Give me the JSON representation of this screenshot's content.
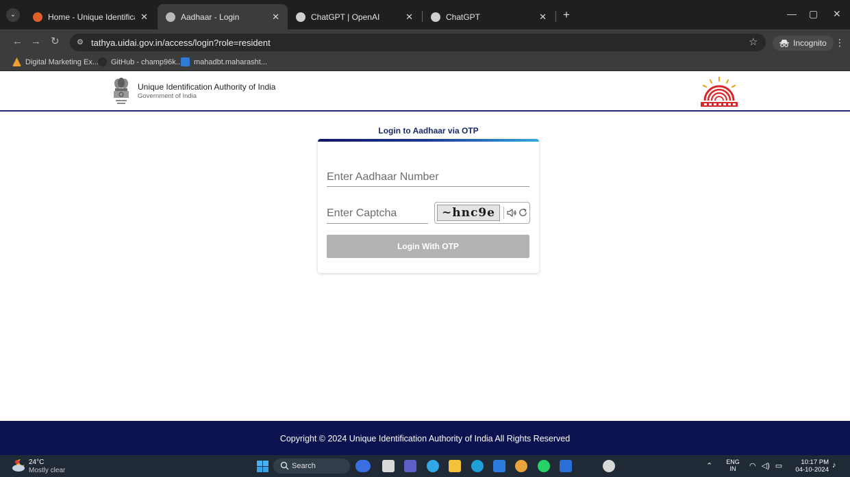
{
  "browser": {
    "tabs": [
      {
        "title": "Home - Unique Identification A",
        "close": "✕",
        "active": false,
        "favicon_color": "#e0602a"
      },
      {
        "title": "Aadhaar - Login",
        "close": "✕",
        "active": true,
        "favicon_color": "#b8b8b8"
      },
      {
        "title": "ChatGPT | OpenAI",
        "close": "✕",
        "active": false,
        "favicon_color": "#cfcfcf"
      },
      {
        "title": "ChatGPT",
        "close": "✕",
        "active": false,
        "favicon_color": "#cfcfcf"
      }
    ],
    "new_tab": "+",
    "url": "tathya.uidai.gov.in/access/login?role=resident",
    "incognito_label": "Incognito",
    "bookmarks": [
      {
        "label": "Digital Marketing Ex...",
        "icon_color": "#f0a030"
      },
      {
        "label": "GitHub - champ96k...",
        "icon_color": "#2a2a2a"
      },
      {
        "label": "mahadbt.maharasht...",
        "icon_color": "#2f7bd8"
      }
    ]
  },
  "site": {
    "org_name": "Unique Identification Authority of India",
    "org_sub": "Government of India"
  },
  "login": {
    "heading": "Login to Aadhaar via OTP",
    "aadhaar_placeholder": "Enter Aadhaar Number",
    "captcha_placeholder": "Enter Captcha",
    "captcha_text": "~hnc9e",
    "button_label": "Login With OTP"
  },
  "footer": {
    "copyright": "Copyright © 2024 Unique Identification Authority of India All Rights Reserved"
  },
  "taskbar": {
    "weather_temp": "24°C",
    "weather_desc": "Mostly clear",
    "search_label": "Search",
    "apps": [
      {
        "name": "widgets",
        "color": "#3a6fe0"
      },
      {
        "name": "task-view",
        "color": "#d9d9d9"
      },
      {
        "name": "teams",
        "color": "#5b5fc7"
      },
      {
        "name": "copilot",
        "color": "#31a9e8"
      },
      {
        "name": "file-explorer",
        "color": "#f3c13a"
      },
      {
        "name": "edge",
        "color": "#1fa0d8"
      },
      {
        "name": "store",
        "color": "#2b7de0"
      },
      {
        "name": "chrome",
        "color": "#e8a33a"
      },
      {
        "name": "whatsapp",
        "color": "#25d366"
      },
      {
        "name": "word",
        "color": "#2b6fd6"
      },
      {
        "name": "chrome-alt",
        "color": "#d8d8d8"
      }
    ],
    "lang_line1": "ENG",
    "lang_line2": "IN",
    "time": "10:17 PM",
    "date": "04-10-2024"
  }
}
